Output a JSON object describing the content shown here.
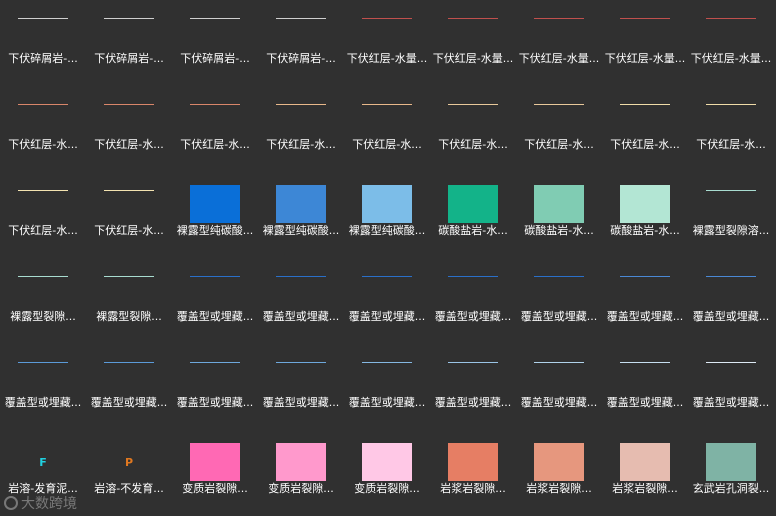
{
  "symbols": [
    {
      "kind": "line",
      "color": "#cfcfcf",
      "label": "下伏碎屑岩-..."
    },
    {
      "kind": "line",
      "color": "#cfcfcf",
      "label": "下伏碎屑岩-..."
    },
    {
      "kind": "line",
      "color": "#cfcfcf",
      "label": "下伏碎屑岩-..."
    },
    {
      "kind": "line",
      "color": "#cfcfcf",
      "label": "下伏碎屑岩-..."
    },
    {
      "kind": "line",
      "color": "#c0504d",
      "label": "下伏红层-水量..."
    },
    {
      "kind": "line",
      "color": "#c0504d",
      "label": "下伏红层-水量..."
    },
    {
      "kind": "line",
      "color": "#c0504d",
      "label": "下伏红层-水量..."
    },
    {
      "kind": "line",
      "color": "#c0504d",
      "label": "下伏红层-水量..."
    },
    {
      "kind": "line",
      "color": "#c0504d",
      "label": "下伏红层-水量..."
    },
    {
      "kind": "line",
      "color": "#d9866a",
      "label": "下伏红层-水..."
    },
    {
      "kind": "line",
      "color": "#d9866a",
      "label": "下伏红层-水..."
    },
    {
      "kind": "line",
      "color": "#d9866a",
      "label": "下伏红层-水..."
    },
    {
      "kind": "line",
      "color": "#e8b88a",
      "label": "下伏红层-水..."
    },
    {
      "kind": "line",
      "color": "#e8b88a",
      "label": "下伏红层-水..."
    },
    {
      "kind": "line",
      "color": "#e8c89a",
      "label": "下伏红层-水..."
    },
    {
      "kind": "line",
      "color": "#e8c89a",
      "label": "下伏红层-水..."
    },
    {
      "kind": "line",
      "color": "#f0dca8",
      "label": "下伏红层-水..."
    },
    {
      "kind": "line",
      "color": "#f0dca8",
      "label": "下伏红层-水..."
    },
    {
      "kind": "line",
      "color": "#f3e3b0",
      "label": "下伏红层-水..."
    },
    {
      "kind": "line",
      "color": "#f3e3b0",
      "label": "下伏红层-水..."
    },
    {
      "kind": "swatch",
      "color": "#0a6fd8",
      "label": "裸露型纯碳酸..."
    },
    {
      "kind": "swatch",
      "color": "#3d87d6",
      "label": "裸露型纯碳酸..."
    },
    {
      "kind": "swatch",
      "color": "#7cbde8",
      "label": "裸露型纯碳酸..."
    },
    {
      "kind": "swatch",
      "color": "#13b389",
      "label": "碳酸盐岩-水..."
    },
    {
      "kind": "swatch",
      "color": "#80ccb3",
      "label": "碳酸盐岩-水..."
    },
    {
      "kind": "swatch",
      "color": "#b3e6d4",
      "label": "碳酸盐岩-水..."
    },
    {
      "kind": "line",
      "color": "#a8dcd0",
      "label": "裸露型裂隙溶..."
    },
    {
      "kind": "line",
      "color": "#a8dcd0",
      "label": "裸露型裂隙..."
    },
    {
      "kind": "line",
      "color": "#a8dcd0",
      "label": "裸露型裂隙..."
    },
    {
      "kind": "line",
      "color": "#2a6fc8",
      "label": "覆盖型或埋藏..."
    },
    {
      "kind": "line",
      "color": "#2a6fc8",
      "label": "覆盖型或埋藏..."
    },
    {
      "kind": "line",
      "color": "#2a6fc8",
      "label": "覆盖型或埋藏..."
    },
    {
      "kind": "line",
      "color": "#2a6fc8",
      "label": "覆盖型或埋藏..."
    },
    {
      "kind": "line",
      "color": "#2a6fc8",
      "label": "覆盖型或埋藏..."
    },
    {
      "kind": "line",
      "color": "#4a88d4",
      "label": "覆盖型或埋藏..."
    },
    {
      "kind": "line",
      "color": "#4a88d4",
      "label": "覆盖型或埋藏..."
    },
    {
      "kind": "line",
      "color": "#5b9ad8",
      "label": "覆盖型或埋藏..."
    },
    {
      "kind": "line",
      "color": "#5b9ad8",
      "label": "覆盖型或埋藏..."
    },
    {
      "kind": "line",
      "color": "#6ea8dc",
      "label": "覆盖型或埋藏..."
    },
    {
      "kind": "line",
      "color": "#6ea8dc",
      "label": "覆盖型或埋藏..."
    },
    {
      "kind": "line",
      "color": "#85b8e2",
      "label": "覆盖型或埋藏..."
    },
    {
      "kind": "line",
      "color": "#9ac4e6",
      "label": "覆盖型或埋藏..."
    },
    {
      "kind": "line",
      "color": "#b0d2ea",
      "label": "覆盖型或埋藏..."
    },
    {
      "kind": "line",
      "color": "#c6def0",
      "label": "覆盖型或埋藏..."
    },
    {
      "kind": "line",
      "color": "#dde9f4",
      "label": "覆盖型或埋藏..."
    },
    {
      "kind": "letter",
      "color": "#20d0e0",
      "text": "F",
      "label": "岩溶-发育泥..."
    },
    {
      "kind": "letter",
      "color": "#e07820",
      "text": "P",
      "label": "岩溶-不发育..."
    },
    {
      "kind": "swatch",
      "color": "#ff69b4",
      "label": "变质岩裂隙..."
    },
    {
      "kind": "swatch",
      "color": "#ff99cc",
      "label": "变质岩裂隙..."
    },
    {
      "kind": "swatch",
      "color": "#ffc8e6",
      "label": "变质岩裂隙..."
    },
    {
      "kind": "swatch",
      "color": "#e67e64",
      "label": "岩浆岩裂隙..."
    },
    {
      "kind": "swatch",
      "color": "#e6977e",
      "label": "岩浆岩裂隙..."
    },
    {
      "kind": "swatch",
      "color": "#e6bcb0",
      "label": "岩浆岩裂隙..."
    },
    {
      "kind": "swatch",
      "color": "#7fb3a5",
      "label": "玄武岩孔洞裂..."
    }
  ],
  "watermark": {
    "text": "大数跨境"
  }
}
